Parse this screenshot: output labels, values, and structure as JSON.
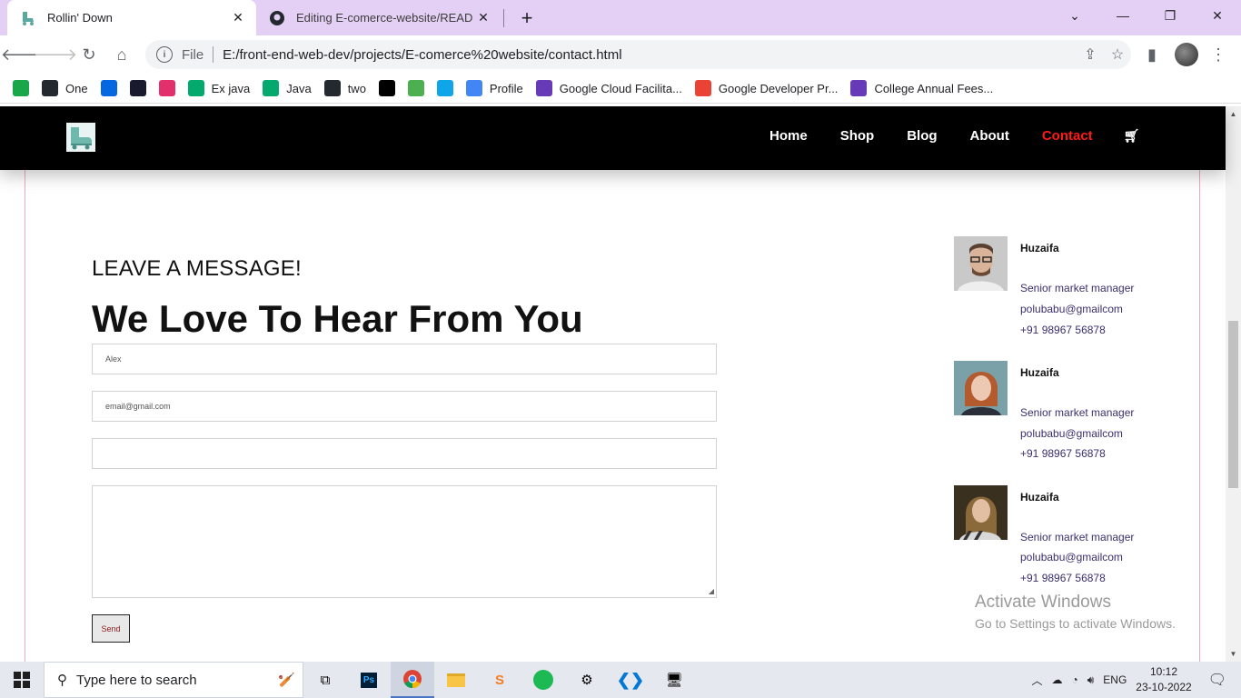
{
  "browser": {
    "tabs": [
      {
        "title": "Rollin' Down",
        "active": true
      },
      {
        "title": "Editing E-comerce-website/READM",
        "active": false
      }
    ],
    "new_tab_symbol": "+",
    "address": {
      "scheme_label": "File",
      "url": "E:/front-end-web-dev/projects/E-comerce%20website/contact.html"
    },
    "bookmarks": [
      {
        "label": "",
        "icon": "green-1-icon",
        "color": "#1aa64b"
      },
      {
        "label": "One",
        "icon": "github-icon",
        "color": "#24292f"
      },
      {
        "label": "",
        "icon": "meta-icon",
        "color": "#0668e1"
      },
      {
        "label": "",
        "icon": "app-icon",
        "color": "#1a1a2e"
      },
      {
        "label": "",
        "icon": "instagram-icon",
        "color": "#e1306c"
      },
      {
        "label": "Ex java",
        "icon": "w3-icon",
        "color": "#04aa6d"
      },
      {
        "label": "Java",
        "icon": "w3-icon",
        "color": "#04aa6d"
      },
      {
        "label": "two",
        "icon": "github-icon",
        "color": "#24292f"
      },
      {
        "label": "",
        "icon": "triangle-icon",
        "color": "#000000"
      },
      {
        "label": "",
        "icon": "leaf-icon",
        "color": "#4caf50"
      },
      {
        "label": "",
        "icon": "ring-icon",
        "color": "#0ea5e9"
      },
      {
        "label": "Profile",
        "icon": "google-cloud-icon",
        "color": "#4285f4"
      },
      {
        "label": "Google Cloud Facilita...",
        "icon": "forms-icon",
        "color": "#673ab7"
      },
      {
        "label": "Google Developer Pr...",
        "icon": "google-dev-icon",
        "color": "#ea4335"
      },
      {
        "label": "College Annual Fees...",
        "icon": "forms-icon",
        "color": "#673ab7"
      }
    ]
  },
  "site": {
    "nav": [
      {
        "label": "Home",
        "current": false
      },
      {
        "label": "Shop",
        "current": false
      },
      {
        "label": "Blog",
        "current": false
      },
      {
        "label": "About",
        "current": false
      },
      {
        "label": "Contact",
        "current": true
      }
    ],
    "accent": "#ff1a1a",
    "form": {
      "kicker": "LEAVE A MESSAGE!",
      "headline": "We Love To Hear From You",
      "name_placeholder": "Alex",
      "email_placeholder": "email@gmail.com",
      "send_label": "Send"
    },
    "contacts": [
      {
        "name": "Huzaifa",
        "role": "Senior market manager",
        "email": "polubabu@gmailcom",
        "phone": "+91 98967 56878"
      },
      {
        "name": "Huzaifa",
        "role": "Senior market manager",
        "email": "polubabu@gmailcom",
        "phone": "+91 98967 56878"
      },
      {
        "name": "Huzaifa",
        "role": "Senior market manager",
        "email": "polubabu@gmailcom",
        "phone": "+91 98967 56878"
      }
    ]
  },
  "watermark": {
    "line1": "Activate Windows",
    "line2": "Go to Settings to activate Windows."
  },
  "taskbar": {
    "search_placeholder": "Type here to search",
    "language": "ENG",
    "time": "10:12",
    "date": "23-10-2022"
  }
}
